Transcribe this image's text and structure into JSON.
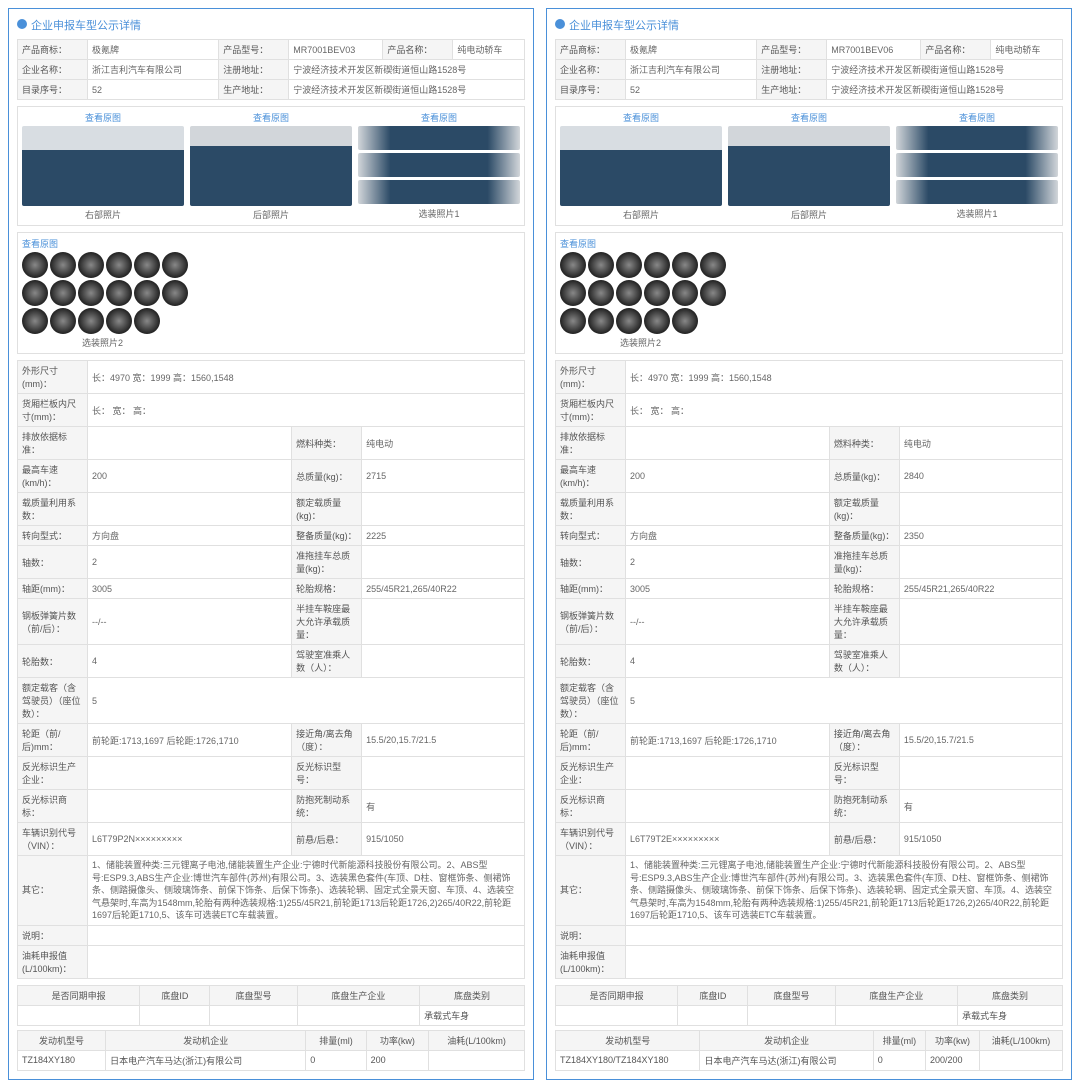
{
  "panel_title": "企业申报车型公示详情",
  "view_original": "查看原图",
  "captions": {
    "side": "右部照片",
    "rear": "后部照片",
    "opt1": "选装照片1",
    "opt2": "选装照片2"
  },
  "spec_labels": {
    "brand": "产品商标：",
    "model": "产品型号：",
    "name": "产品名称：",
    "company": "企业名称：",
    "reg_addr": "注册地址：",
    "catalog_no": "目录序号：",
    "prod_addr": "生产地址：",
    "dims": "外形尺寸(mm)：",
    "cargo": "货厢栏板内尺寸(mm)：",
    "emission": "排放依据标准：",
    "fuel": "燃料种类：",
    "top_speed": "最高车速(km/h)：",
    "total_mass": "总质量(kg)：",
    "load_coef": "载质量利用系数：",
    "rated_load": "额定载质量(kg)：",
    "steering": "转向型式：",
    "curb_mass": "整备质量(kg)：",
    "axles": "轴数：",
    "trailer_mass": "准拖挂车总质量(kg)：",
    "wheelbase": "轴距(mm)：",
    "tire_spec": "轮胎规格：",
    "leaf_springs": "钢板弹簧片数（前/后）：",
    "saddle_mass": "半挂车鞍座最大允许承载质量：",
    "tire_count": "轮胎数：",
    "cab_seats": "驾驶室准乘人数（人）：",
    "rated_seats": "额定载客（含驾驶员）（座位数）：",
    "track": "轮距（前/后)mm：",
    "angles": "接近角/离去角（度）：",
    "refl_mfr": "反光标识生产企业：",
    "refl_model": "反光标识型号：",
    "refl_trademark": "反光标识商标：",
    "abs": "防抱死制动系统：",
    "vin": "车辆识别代号（VIN）：",
    "overhang": "前悬/后悬：",
    "other": "其它：",
    "remarks": "说明：",
    "fuel_declared": "油耗申报值(L/100km)："
  },
  "chassis_headers": {
    "same_period": "是否同期申报",
    "chassis_id": "底盘ID",
    "chassis_model": "底盘型号",
    "chassis_mfr": "底盘生产企业",
    "chassis_type": "底盘类别",
    "body_type": "承载式车身"
  },
  "engine_headers": {
    "engine_model": "发动机型号",
    "engine_mfr": "发动机企业",
    "displacement": "排量(ml)",
    "power": "功率(kw)",
    "fuel_cons": "油耗(L/100km)"
  },
  "shared_values": {
    "brand": "极氪牌",
    "name": "纯电动轿车",
    "company": "浙江吉利汽车有限公司",
    "reg_addr": "宁波经济技术开发区新碶街道恒山路1528号",
    "prod_addr": "宁波经济技术开发区新碶街道恒山路1528号",
    "catalog_no": "52",
    "dims": "长：4970 宽：1999 高：1560,1548",
    "cargo": "长： 宽： 高：",
    "fuel": "纯电动",
    "top_speed": "200",
    "steering": "方向盘",
    "axles": "2",
    "wheelbase": "3005",
    "tire_spec": "255/45R21,265/40R22",
    "leaf_springs": "--/--",
    "tire_count": "4",
    "rated_seats": "5",
    "track": "前轮距:1713,1697 后轮距:1726,1710",
    "angles": "15.5/20,15.7/21.5",
    "abs": "有",
    "overhang": "915/1050",
    "engine_mfr": "日本电产汽车马达(浙江)有限公司",
    "displacement": "0"
  },
  "left": {
    "model": "MR7001BEV03",
    "total_mass": "2715",
    "curb_mass": "2225",
    "vin": "L6T79P2N×××××××××",
    "other": "1、储能装置种类:三元锂离子电池,储能装置生产企业:宁德时代新能源科技股份有限公司。2、ABS型号:ESP9.3,ABS生产企业:博世汽车部件(苏州)有限公司。3、选装黑色套件(车顶、D柱、窗框饰条、侧裙饰条、侧踏摄像头、侧玻璃饰条、前保下饰条、后保下饰条)、选装轮辋、固定式全景天窗、车顶、4、选装空气悬架时,车高为1548mm,轮胎有两种选装规格:1)255/45R21,前轮距1713后轮距1726,2)265/40R22,前轮距1697后轮距1710,5、该车可选装ETC车载装置。",
    "engine_model": "TZ184XY180",
    "power": "200"
  },
  "right": {
    "model": "MR7001BEV06",
    "total_mass": "2840",
    "curb_mass": "2350",
    "vin": "L6T79T2E×××××××××",
    "other": "1、储能装置种类:三元锂离子电池,储能装置生产企业:宁德时代新能源科技股份有限公司。2、ABS型号:ESP9.3,ABS生产企业:博世汽车部件(苏州)有限公司。3、选装黑色套件(车顶、D柱、窗框饰条、侧裙饰条、侧踏摄像头、侧玻璃饰条、前保下饰条、后保下饰条)、选装轮辋、固定式全景天窗、车顶。4、选装空气悬架时,车高为1548mm,轮胎有两种选装规格:1)255/45R21,前轮距1713后轮距1726,2)265/40R22,前轮距1697后轮距1710,5、该车可选装ETC车载装置。",
    "engine_model": "TZ184XY180/TZ184XY180",
    "power": "200/200"
  }
}
